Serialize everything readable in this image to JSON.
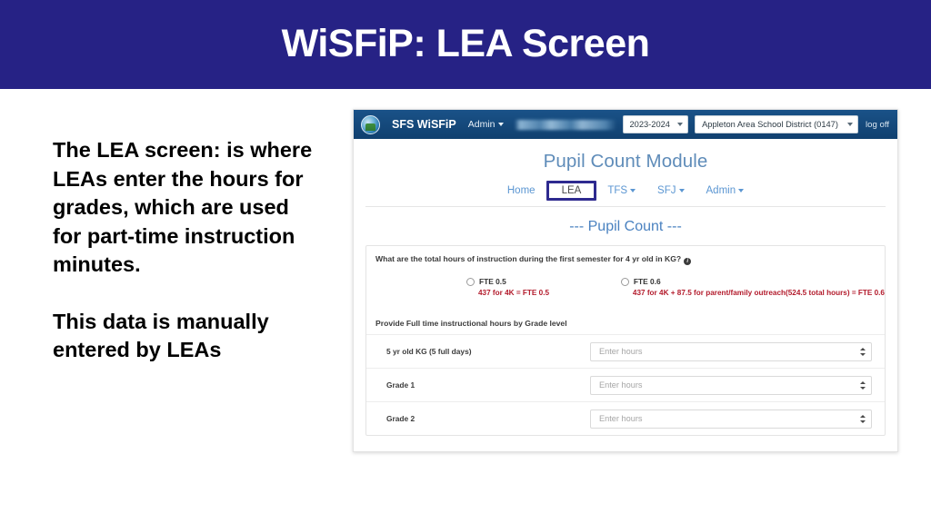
{
  "slide": {
    "title": "WiSFiP: LEA Screen",
    "banner_color": "#262285",
    "body_paragraph_1": "The LEA screen: is where LEAs enter the hours for grades, which are used for part-time instruction minutes.",
    "body_paragraph_2": "This data is manually entered by LEAs"
  },
  "app": {
    "navbar": {
      "logo_icon": "globe-logo-icon",
      "brand": "SFS WiSFiP",
      "admin_menu": "Admin",
      "redacted_user_text": "",
      "year_select": {
        "value": "2023-2024",
        "caret_icon": "chevron-down-icon"
      },
      "district_select": {
        "value": "Appleton Area School District (0147)",
        "caret_icon": "chevron-down-icon"
      },
      "log_off": "log off"
    },
    "module_title": "Pupil Count Module",
    "tabs": [
      {
        "label": "Home",
        "active": false,
        "has_caret": false
      },
      {
        "label": "LEA",
        "active": true,
        "has_caret": false
      },
      {
        "label": "TFS",
        "active": false,
        "has_caret": true
      },
      {
        "label": "SFJ",
        "active": false,
        "has_caret": true
      },
      {
        "label": "Admin",
        "active": false,
        "has_caret": true
      }
    ],
    "section_title": "--- Pupil Count ---",
    "card": {
      "question": "What are the total hours of instruction during the first semester for 4 yr old in KG?",
      "info_icon": "info-icon",
      "options": [
        {
          "label": "FTE 0.5",
          "note": "437 for 4K = FTE 0.5",
          "selected": false
        },
        {
          "label": "FTE 0.6",
          "note": "437 for 4K + 87.5 for parent/family outreach(524.5 total hours) = FTE 0.6",
          "selected": false
        }
      ],
      "note_color": "#b31b2c",
      "grade_heading": "Provide Full time instructional hours by Grade level",
      "grade_rows": [
        {
          "label": "5 yr old KG (5 full days)",
          "value": "",
          "placeholder": "Enter hours"
        },
        {
          "label": "Grade 1",
          "value": "",
          "placeholder": "Enter hours"
        },
        {
          "label": "Grade 2",
          "value": "",
          "placeholder": "Enter hours"
        }
      ]
    }
  }
}
